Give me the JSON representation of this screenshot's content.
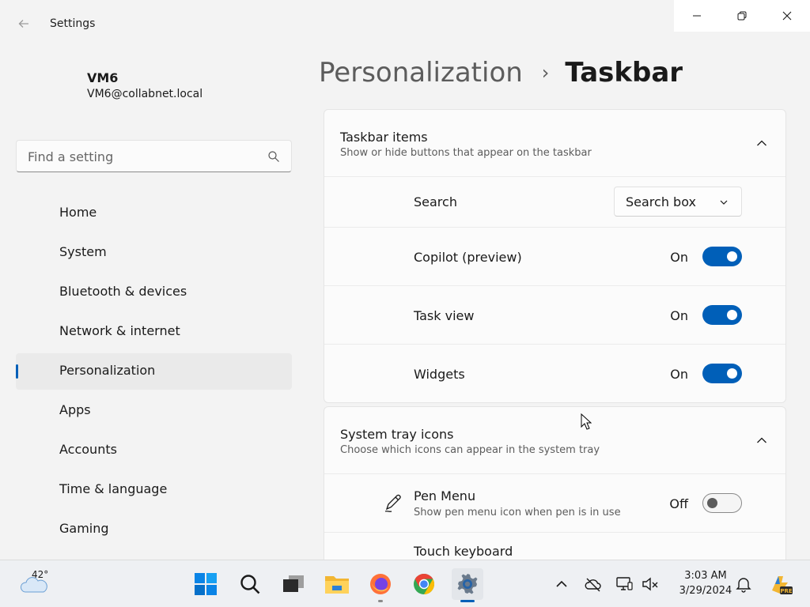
{
  "app": {
    "title": "Settings",
    "colors": {
      "accent": "#005fb8",
      "background": "#f3f3f3",
      "card": "#fbfbfb"
    }
  },
  "profile": {
    "name": "VM6",
    "email": "VM6@collabnet.local"
  },
  "search": {
    "placeholder": "Find a setting",
    "value": ""
  },
  "nav": {
    "items": [
      {
        "label": "Home"
      },
      {
        "label": "System"
      },
      {
        "label": "Bluetooth & devices"
      },
      {
        "label": "Network & internet"
      },
      {
        "label": "Personalization",
        "selected": true
      },
      {
        "label": "Apps"
      },
      {
        "label": "Accounts"
      },
      {
        "label": "Time & language"
      },
      {
        "label": "Gaming"
      }
    ]
  },
  "header": {
    "parent": "Personalization",
    "separator": "›",
    "current": "Taskbar"
  },
  "taskbar_items": {
    "title": "Taskbar items",
    "description": "Show or hide buttons that appear on the taskbar",
    "rows": [
      {
        "label": "Search",
        "control": "dropdown",
        "value": "Search box"
      },
      {
        "label": "Copilot (preview)",
        "state": "On",
        "toggle": true
      },
      {
        "label": "Task view",
        "state": "On",
        "toggle": true
      },
      {
        "label": "Widgets",
        "state": "On",
        "toggle": true
      }
    ]
  },
  "system_tray": {
    "title": "System tray icons",
    "description": "Choose which icons can appear in the system tray",
    "rows": [
      {
        "label": "Pen Menu",
        "description": "Show pen menu icon when pen is in use",
        "state": "Off",
        "toggle": false,
        "icon": "pen-icon"
      },
      {
        "label": "Touch keyboard"
      }
    ]
  },
  "taskbar": {
    "weather": {
      "temp": "42°",
      "icon": "cloud-weather-icon"
    },
    "apps": [
      "start-icon",
      "search-icon",
      "task-view-icon",
      "file-explorer-icon",
      "firefox-icon",
      "chrome-icon",
      "settings-icon"
    ],
    "tray": [
      "chevron-up-icon",
      "cloud-offline-icon",
      "display-icon",
      "speaker-muted-icon"
    ],
    "clock": {
      "time": "3:03 AM",
      "date": "3/29/2024"
    }
  }
}
